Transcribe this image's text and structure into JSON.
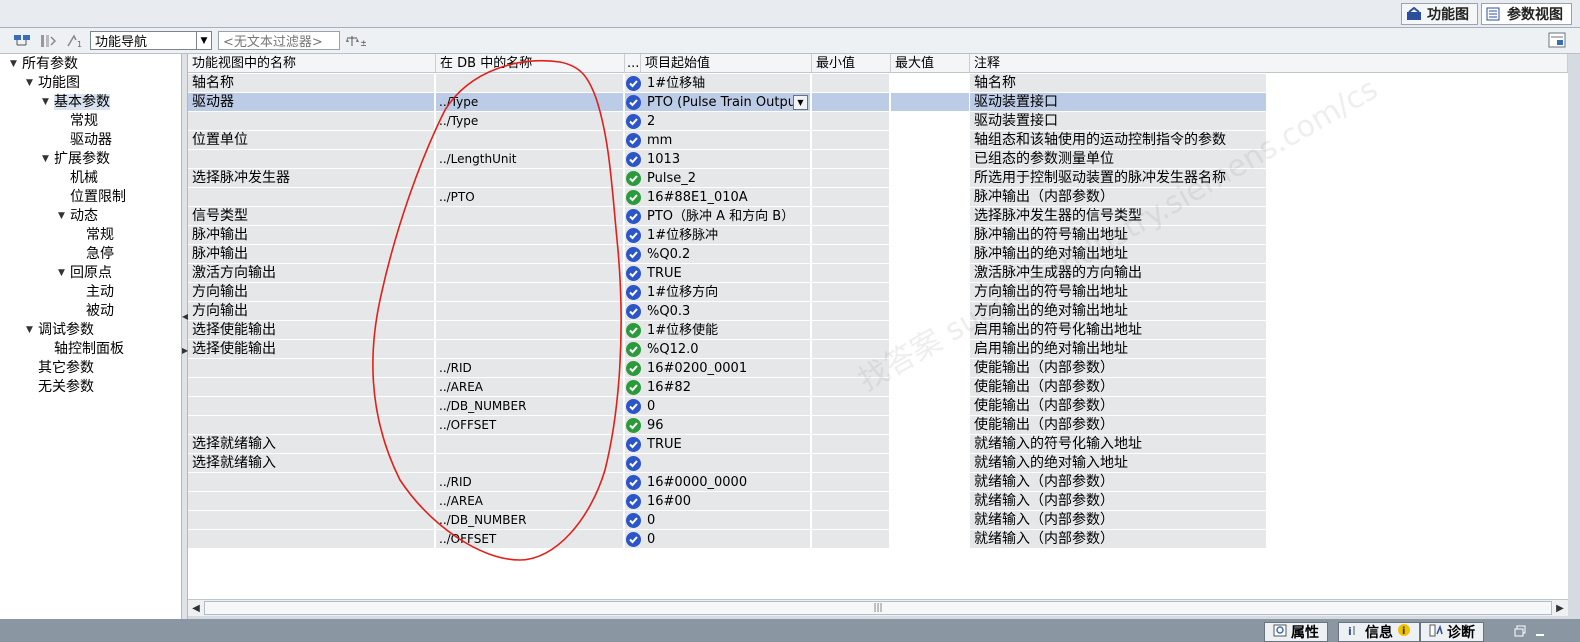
{
  "view_tabs": [
    {
      "label": "功能图",
      "icon": "function-view-icon",
      "active": false
    },
    {
      "label": "参数视图",
      "icon": "parameter-view-icon",
      "active": true
    }
  ],
  "toolbar": {
    "nav_select": "功能导航",
    "filter_placeholder": "<无文本过滤器>"
  },
  "tree": [
    {
      "label": "所有参数",
      "level": 0,
      "expanded": true
    },
    {
      "label": "功能图",
      "level": 1,
      "expanded": true
    },
    {
      "label": "基本参数",
      "level": 2,
      "expanded": true,
      "selected": true
    },
    {
      "label": "常规",
      "level": 3
    },
    {
      "label": "驱动器",
      "level": 3
    },
    {
      "label": "扩展参数",
      "level": 2,
      "expanded": true
    },
    {
      "label": "机械",
      "level": 3
    },
    {
      "label": "位置限制",
      "level": 3
    },
    {
      "label": "动态",
      "level": 3,
      "expanded": true
    },
    {
      "label": "常规",
      "level": 4
    },
    {
      "label": "急停",
      "level": 4
    },
    {
      "label": "回原点",
      "level": 3,
      "expanded": true
    },
    {
      "label": "主动",
      "level": 4
    },
    {
      "label": "被动",
      "level": 4
    },
    {
      "label": "调试参数",
      "level": 1,
      "expanded": true
    },
    {
      "label": "轴控制面板",
      "level": 2
    },
    {
      "label": "其它参数",
      "level": 1
    },
    {
      "label": "无关参数",
      "level": 1
    }
  ],
  "table": {
    "headers": [
      "功能视图中的名称",
      "在 DB 中的名称",
      "...",
      "项目起始值",
      "最小值",
      "最大值",
      "注释"
    ],
    "rows": [
      {
        "name": "轴名称",
        "db": "",
        "status": "blue",
        "value": "1#位移轴",
        "comment": "轴名称"
      },
      {
        "name": "驱动器",
        "db": "../Type",
        "status": "blue",
        "value": "PTO (Pulse Train Output)",
        "comment": "驱动装置接口",
        "selected": true,
        "dropdown": true
      },
      {
        "name": "",
        "db": "../Type",
        "status": "blue",
        "value": "2",
        "comment": "驱动装置接口"
      },
      {
        "name": "位置单位",
        "db": "",
        "status": "blue",
        "value": "mm",
        "comment": "轴组态和该轴使用的运动控制指令的参数"
      },
      {
        "name": "",
        "db": "../LengthUnit",
        "status": "blue",
        "value": "1013",
        "comment": "已组态的参数测量单位"
      },
      {
        "name": "选择脉冲发生器",
        "db": "",
        "status": "green",
        "value": "Pulse_2",
        "comment": "所选用于控制驱动装置的脉冲发生器名称"
      },
      {
        "name": "",
        "db": "../PTO",
        "status": "green",
        "value": "16#88E1_010A",
        "comment": "脉冲输出（内部参数）"
      },
      {
        "name": "信号类型",
        "db": "",
        "status": "blue",
        "value": "PTO（脉冲 A 和方向 B）",
        "comment": "选择脉冲发生器的信号类型"
      },
      {
        "name": "脉冲输出",
        "db": "",
        "status": "blue",
        "value": "1#位移脉冲",
        "comment": "脉冲输出的符号输出地址"
      },
      {
        "name": "脉冲输出",
        "db": "",
        "status": "blue",
        "value": "%Q0.2",
        "comment": "脉冲输出的绝对输出地址"
      },
      {
        "name": "激活方向输出",
        "db": "",
        "status": "blue",
        "value": "TRUE",
        "comment": "激活脉冲生成器的方向输出"
      },
      {
        "name": "方向输出",
        "db": "",
        "status": "blue",
        "value": "1#位移方向",
        "comment": "方向输出的符号输出地址"
      },
      {
        "name": "方向输出",
        "db": "",
        "status": "blue",
        "value": "%Q0.3",
        "comment": "方向输出的绝对输出地址"
      },
      {
        "name": "选择使能输出",
        "db": "",
        "status": "green",
        "value": "1#位移使能",
        "comment": "启用输出的符号化输出地址"
      },
      {
        "name": "选择使能输出",
        "db": "",
        "status": "green",
        "value": "%Q12.0",
        "comment": "启用输出的绝对输出地址"
      },
      {
        "name": "",
        "db": "../RID",
        "status": "green",
        "value": "16#0200_0001",
        "comment": "使能输出（内部参数）"
      },
      {
        "name": "",
        "db": "../AREA",
        "status": "green",
        "value": "16#82",
        "comment": "使能输出（内部参数）"
      },
      {
        "name": "",
        "db": "../DB_NUMBER",
        "status": "blue",
        "value": "0",
        "comment": "使能输出（内部参数）"
      },
      {
        "name": "",
        "db": "../OFFSET",
        "status": "green",
        "value": "96",
        "comment": "使能输出（内部参数）"
      },
      {
        "name": "选择就绪输入",
        "db": "",
        "status": "blue",
        "value": "TRUE",
        "comment": "就绪输入的符号化输入地址"
      },
      {
        "name": "选择就绪输入",
        "db": "",
        "status": "blue",
        "value": "",
        "comment": "就绪输入的绝对输入地址"
      },
      {
        "name": "",
        "db": "../RID",
        "status": "blue",
        "value": "16#0000_0000",
        "comment": "就绪输入（内部参数）"
      },
      {
        "name": "",
        "db": "../AREA",
        "status": "blue",
        "value": "16#00",
        "comment": "就绪输入（内部参数）"
      },
      {
        "name": "",
        "db": "../DB_NUMBER",
        "status": "blue",
        "value": "0",
        "comment": "就绪输入（内部参数）"
      },
      {
        "name": "",
        "db": "../OFFSET",
        "status": "blue",
        "value": "0",
        "comment": "就绪输入（内部参数）"
      }
    ]
  },
  "bottom_tabs": [
    {
      "label": "属性",
      "icon": "properties-icon"
    },
    {
      "label": "信息",
      "icon": "info-icon"
    },
    {
      "label": "诊断",
      "icon": "diagnostics-icon"
    }
  ],
  "watermark": "找答案 support.industry.siemens.com/cs",
  "colors": {
    "status_blue": "#2b55c9",
    "status_green": "#2a9a3a",
    "selected_row": "#bccbe6",
    "annotation_red": "#e0201a"
  }
}
